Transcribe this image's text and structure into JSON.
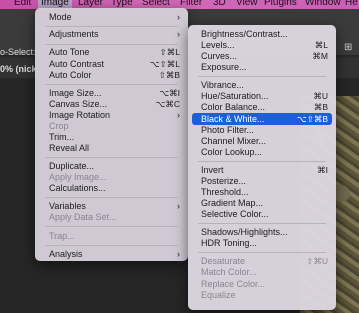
{
  "menubar": {
    "items": [
      "Edit",
      "Image",
      "Layer",
      "Type",
      "Select",
      "Filter",
      "3D",
      "View",
      "Plugins",
      "Window",
      "He"
    ]
  },
  "optionsbar": {
    "auto_select_label": "o-Select:"
  },
  "document_tab": {
    "label": "0% (nick,"
  },
  "image_menu": {
    "items": [
      {
        "label": "Mode",
        "submenu": true
      },
      {
        "label": "Adjustments",
        "submenu": true
      },
      {
        "label": "Auto Tone",
        "shortcut": "⇧⌘L"
      },
      {
        "label": "Auto Contrast",
        "shortcut": "⌥⇧⌘L"
      },
      {
        "label": "Auto Color",
        "shortcut": "⇧⌘B"
      },
      {
        "label": "Image Size...",
        "shortcut": "⌥⌘I"
      },
      {
        "label": "Canvas Size...",
        "shortcut": "⌥⌘C"
      },
      {
        "label": "Image Rotation",
        "submenu": true
      },
      {
        "label": "Crop",
        "disabled": true
      },
      {
        "label": "Trim..."
      },
      {
        "label": "Reveal All"
      },
      {
        "label": "Duplicate..."
      },
      {
        "label": "Apply Image...",
        "disabled": true
      },
      {
        "label": "Calculations..."
      },
      {
        "label": "Variables",
        "submenu": true
      },
      {
        "label": "Apply Data Set...",
        "disabled": true
      },
      {
        "label": "Trap...",
        "disabled": true
      },
      {
        "label": "Analysis",
        "submenu": true
      }
    ]
  },
  "adjustments_menu": {
    "items": [
      {
        "label": "Brightness/Contrast..."
      },
      {
        "label": "Levels...",
        "shortcut": "⌘L"
      },
      {
        "label": "Curves...",
        "shortcut": "⌘M"
      },
      {
        "label": "Exposure..."
      },
      {
        "label": "Vibrance..."
      },
      {
        "label": "Hue/Saturation...",
        "shortcut": "⌘U"
      },
      {
        "label": "Color Balance...",
        "shortcut": "⌘B"
      },
      {
        "label": "Black & White...",
        "shortcut": "⌥⇧⌘B",
        "highlighted": true
      },
      {
        "label": "Photo Filter..."
      },
      {
        "label": "Channel Mixer..."
      },
      {
        "label": "Color Lookup..."
      },
      {
        "label": "Invert",
        "shortcut": "⌘I"
      },
      {
        "label": "Posterize..."
      },
      {
        "label": "Threshold..."
      },
      {
        "label": "Gradient Map..."
      },
      {
        "label": "Selective Color..."
      },
      {
        "label": "Shadows/Highlights..."
      },
      {
        "label": "HDR Toning..."
      },
      {
        "label": "Desaturate",
        "shortcut": "⇧⌘U",
        "disabled": true
      },
      {
        "label": "Match Color...",
        "disabled": true
      },
      {
        "label": "Replace Color...",
        "disabled": true
      },
      {
        "label": "Equalize",
        "disabled": true
      }
    ]
  },
  "colors": {
    "menubar": "#c95fb4",
    "highlight": "#1e5fd6",
    "menu_bg": "#d6ceda"
  }
}
